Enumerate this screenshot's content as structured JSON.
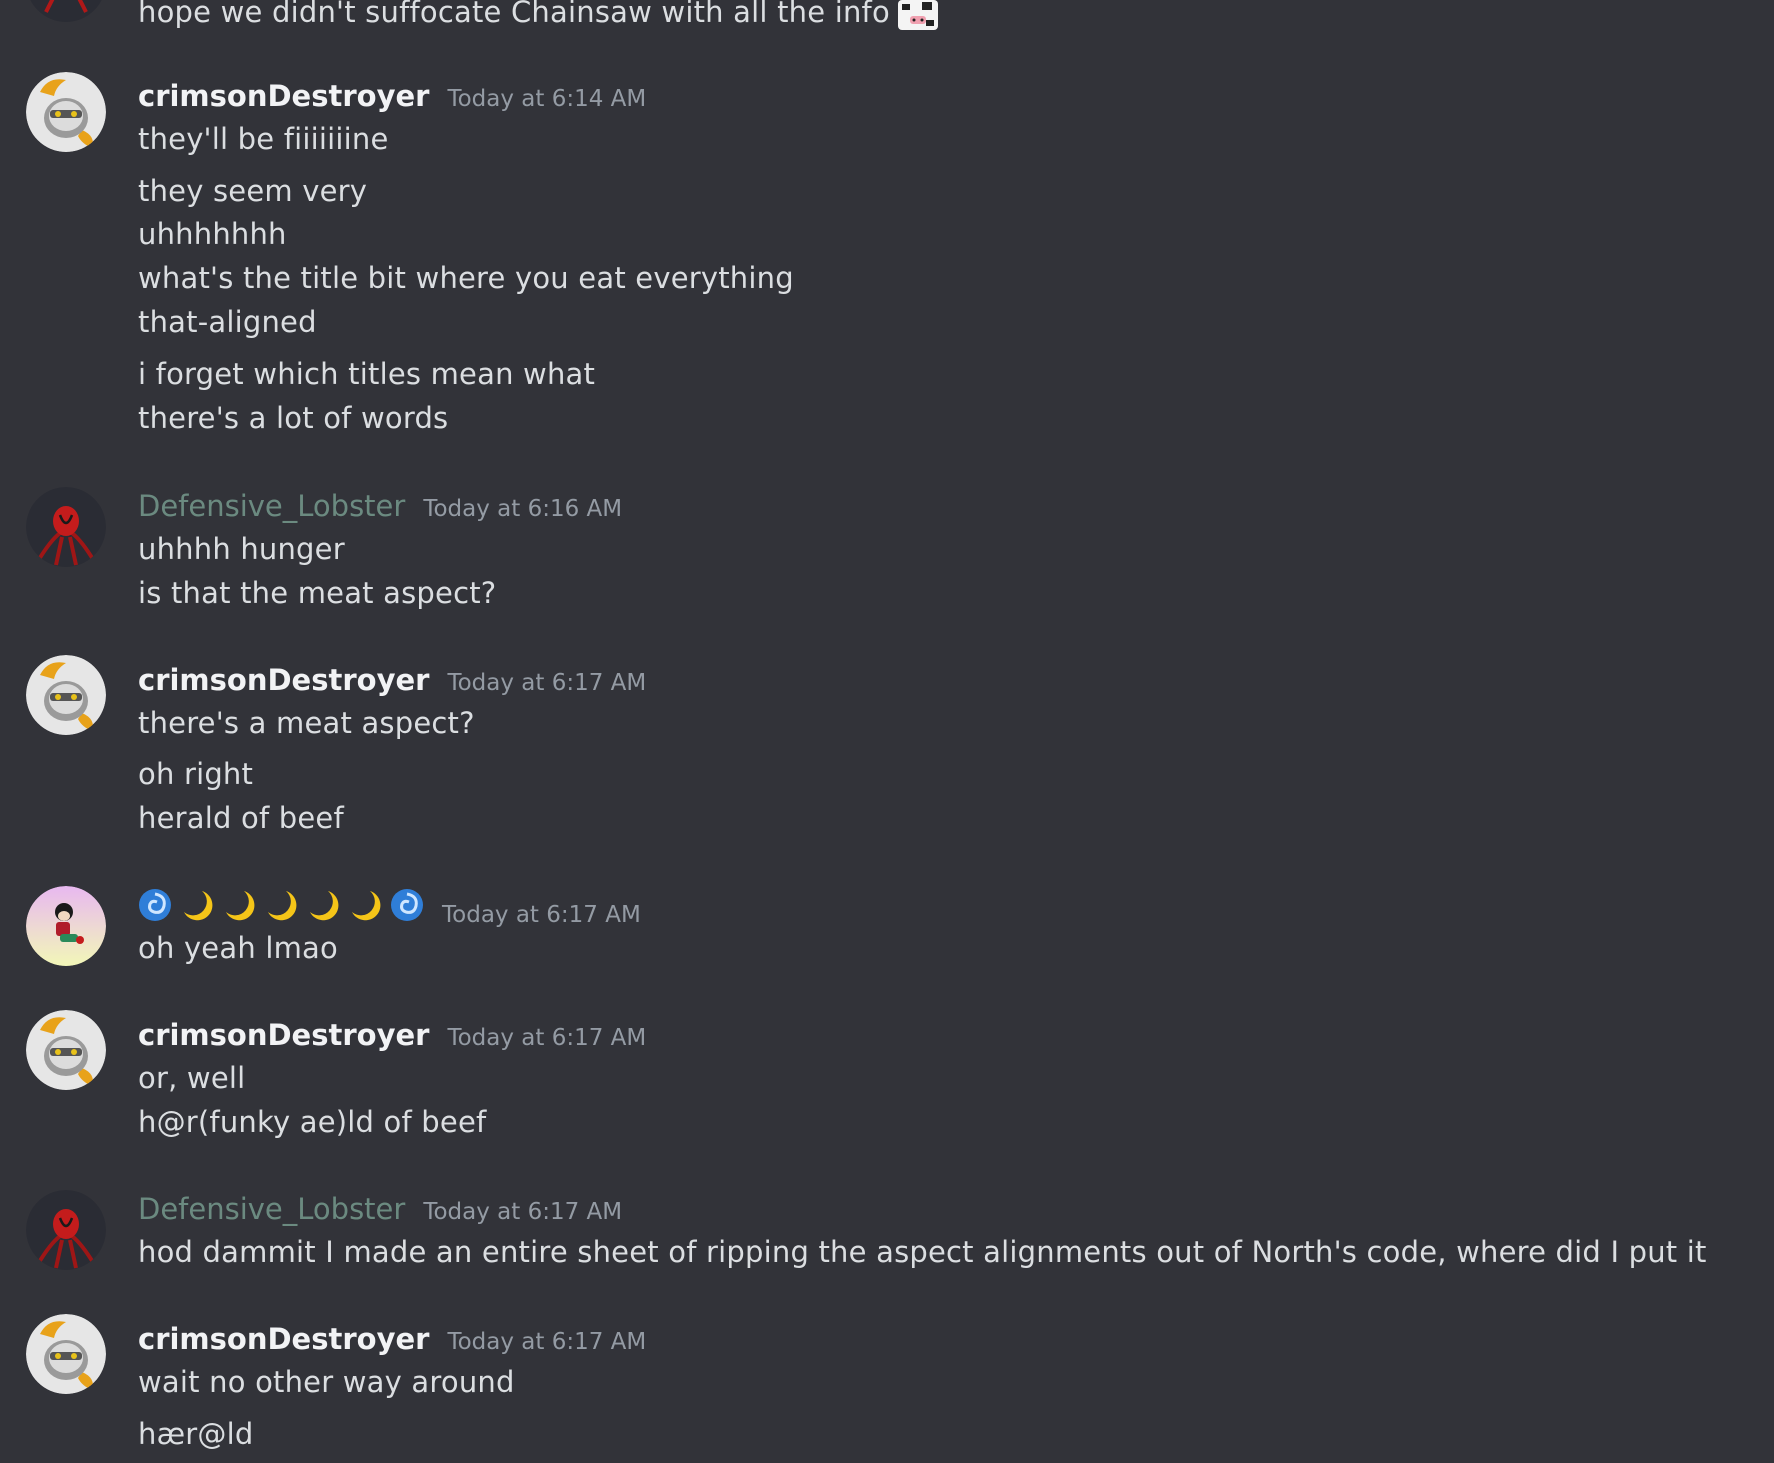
{
  "messages": [
    {
      "id": "m0",
      "lines": [
        "hope we didn't suffocate Chainsaw with all the info"
      ],
      "has_sticker": true
    },
    {
      "id": "m1",
      "user": "crimsonDestroyer",
      "avatar": "crimson-avatar-icon",
      "time": "Today at 6:14 AM",
      "lines": [
        "they'll be fiiiiiiine",
        "they seem very",
        "uhhhhhhh",
        "what's the title bit where you eat everything",
        "that-aligned",
        "i forget which titles mean what",
        "there's a lot of words"
      ]
    },
    {
      "id": "m2",
      "user": "Defensive_Lobster",
      "avatar": "lobster-avatar-icon",
      "time": "Today at 6:16 AM",
      "lines": [
        "uhhhh hunger",
        "is that the meat aspect?"
      ]
    },
    {
      "id": "m3",
      "user": "crimsonDestroyer",
      "avatar": "crimson-avatar-icon",
      "time": "Today at 6:17 AM",
      "lines": [
        "there's a meat aspect?",
        "oh right",
        "herald of beef"
      ]
    },
    {
      "id": "m4",
      "user_emojis": [
        "cyclone-icon",
        "crescent-moon-icon",
        "crescent-moon-icon",
        "crescent-moon-icon",
        "crescent-moon-icon",
        "crescent-moon-icon",
        "cyclone-icon"
      ],
      "avatar": "girl-avatar-icon",
      "time": "Today at 6:17 AM",
      "lines": [
        "oh yeah lmao"
      ]
    },
    {
      "id": "m5",
      "user": "crimsonDestroyer",
      "avatar": "crimson-avatar-icon",
      "time": "Today at 6:17 AM",
      "lines": [
        "or, well",
        "h@r(funky ae)ld of beef"
      ]
    },
    {
      "id": "m6",
      "user": "Defensive_Lobster",
      "avatar": "lobster-avatar-icon",
      "time": "Today at 6:17 AM",
      "lines": [
        "hod dammit I made an entire sheet of ripping the aspect alignments out of North's code, where did I put it"
      ]
    },
    {
      "id": "m7",
      "user": "crimsonDestroyer",
      "avatar": "crimson-avatar-icon",
      "time": "Today at 6:17 AM",
      "lines": [
        "wait no other way around",
        "hær@ld"
      ]
    }
  ],
  "colors": {
    "background": "#323339",
    "text": "#dbdee1",
    "username": "#f2f3f5",
    "lobster_username": "#6b8a80",
    "timestamp": "#949ba4"
  }
}
